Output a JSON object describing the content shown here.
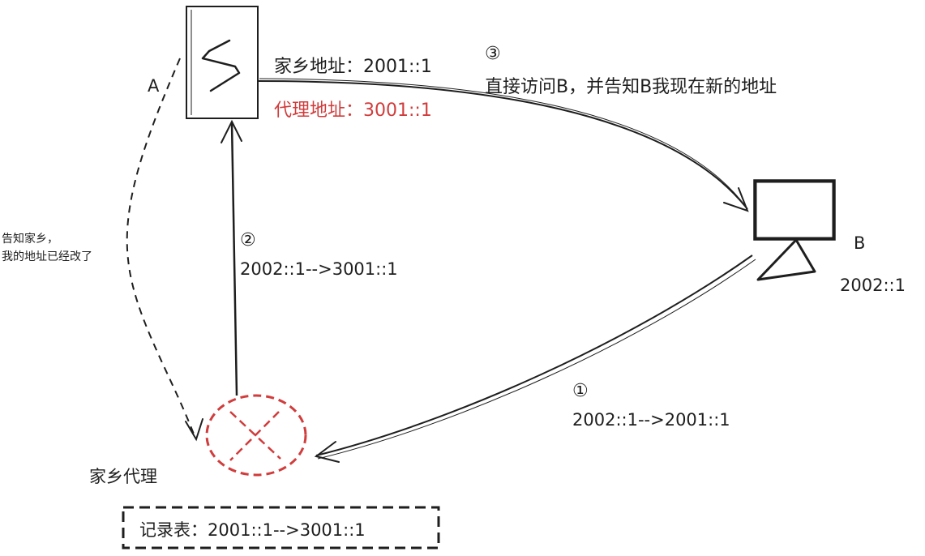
{
  "labels": {
    "node_a": "A",
    "node_b": "B",
    "node_b_address": "2002::1",
    "home_address": "家乡地址：2001::1",
    "proxy_address": "代理地址：3001::1",
    "step3_num": "③",
    "step3_text": "直接访问B，并告知B我现在新的地址",
    "notify_line1": "告知家乡，",
    "notify_line2": "我的地址已经改了",
    "step2_num": "②",
    "step2_text": "2002::1-->3001::1",
    "step1_num": "①",
    "step1_text": "2002::1-->2001::1",
    "home_agent": "家乡代理",
    "record_table": "记录表：2001::1-->3001::1"
  },
  "colors": {
    "stroke": "#1e1e1e",
    "accent_red": "#d13c3c"
  },
  "icons": {
    "phone": "phone-icon",
    "computer": "computer-icon",
    "home_agent": "crossed-circle-icon"
  }
}
